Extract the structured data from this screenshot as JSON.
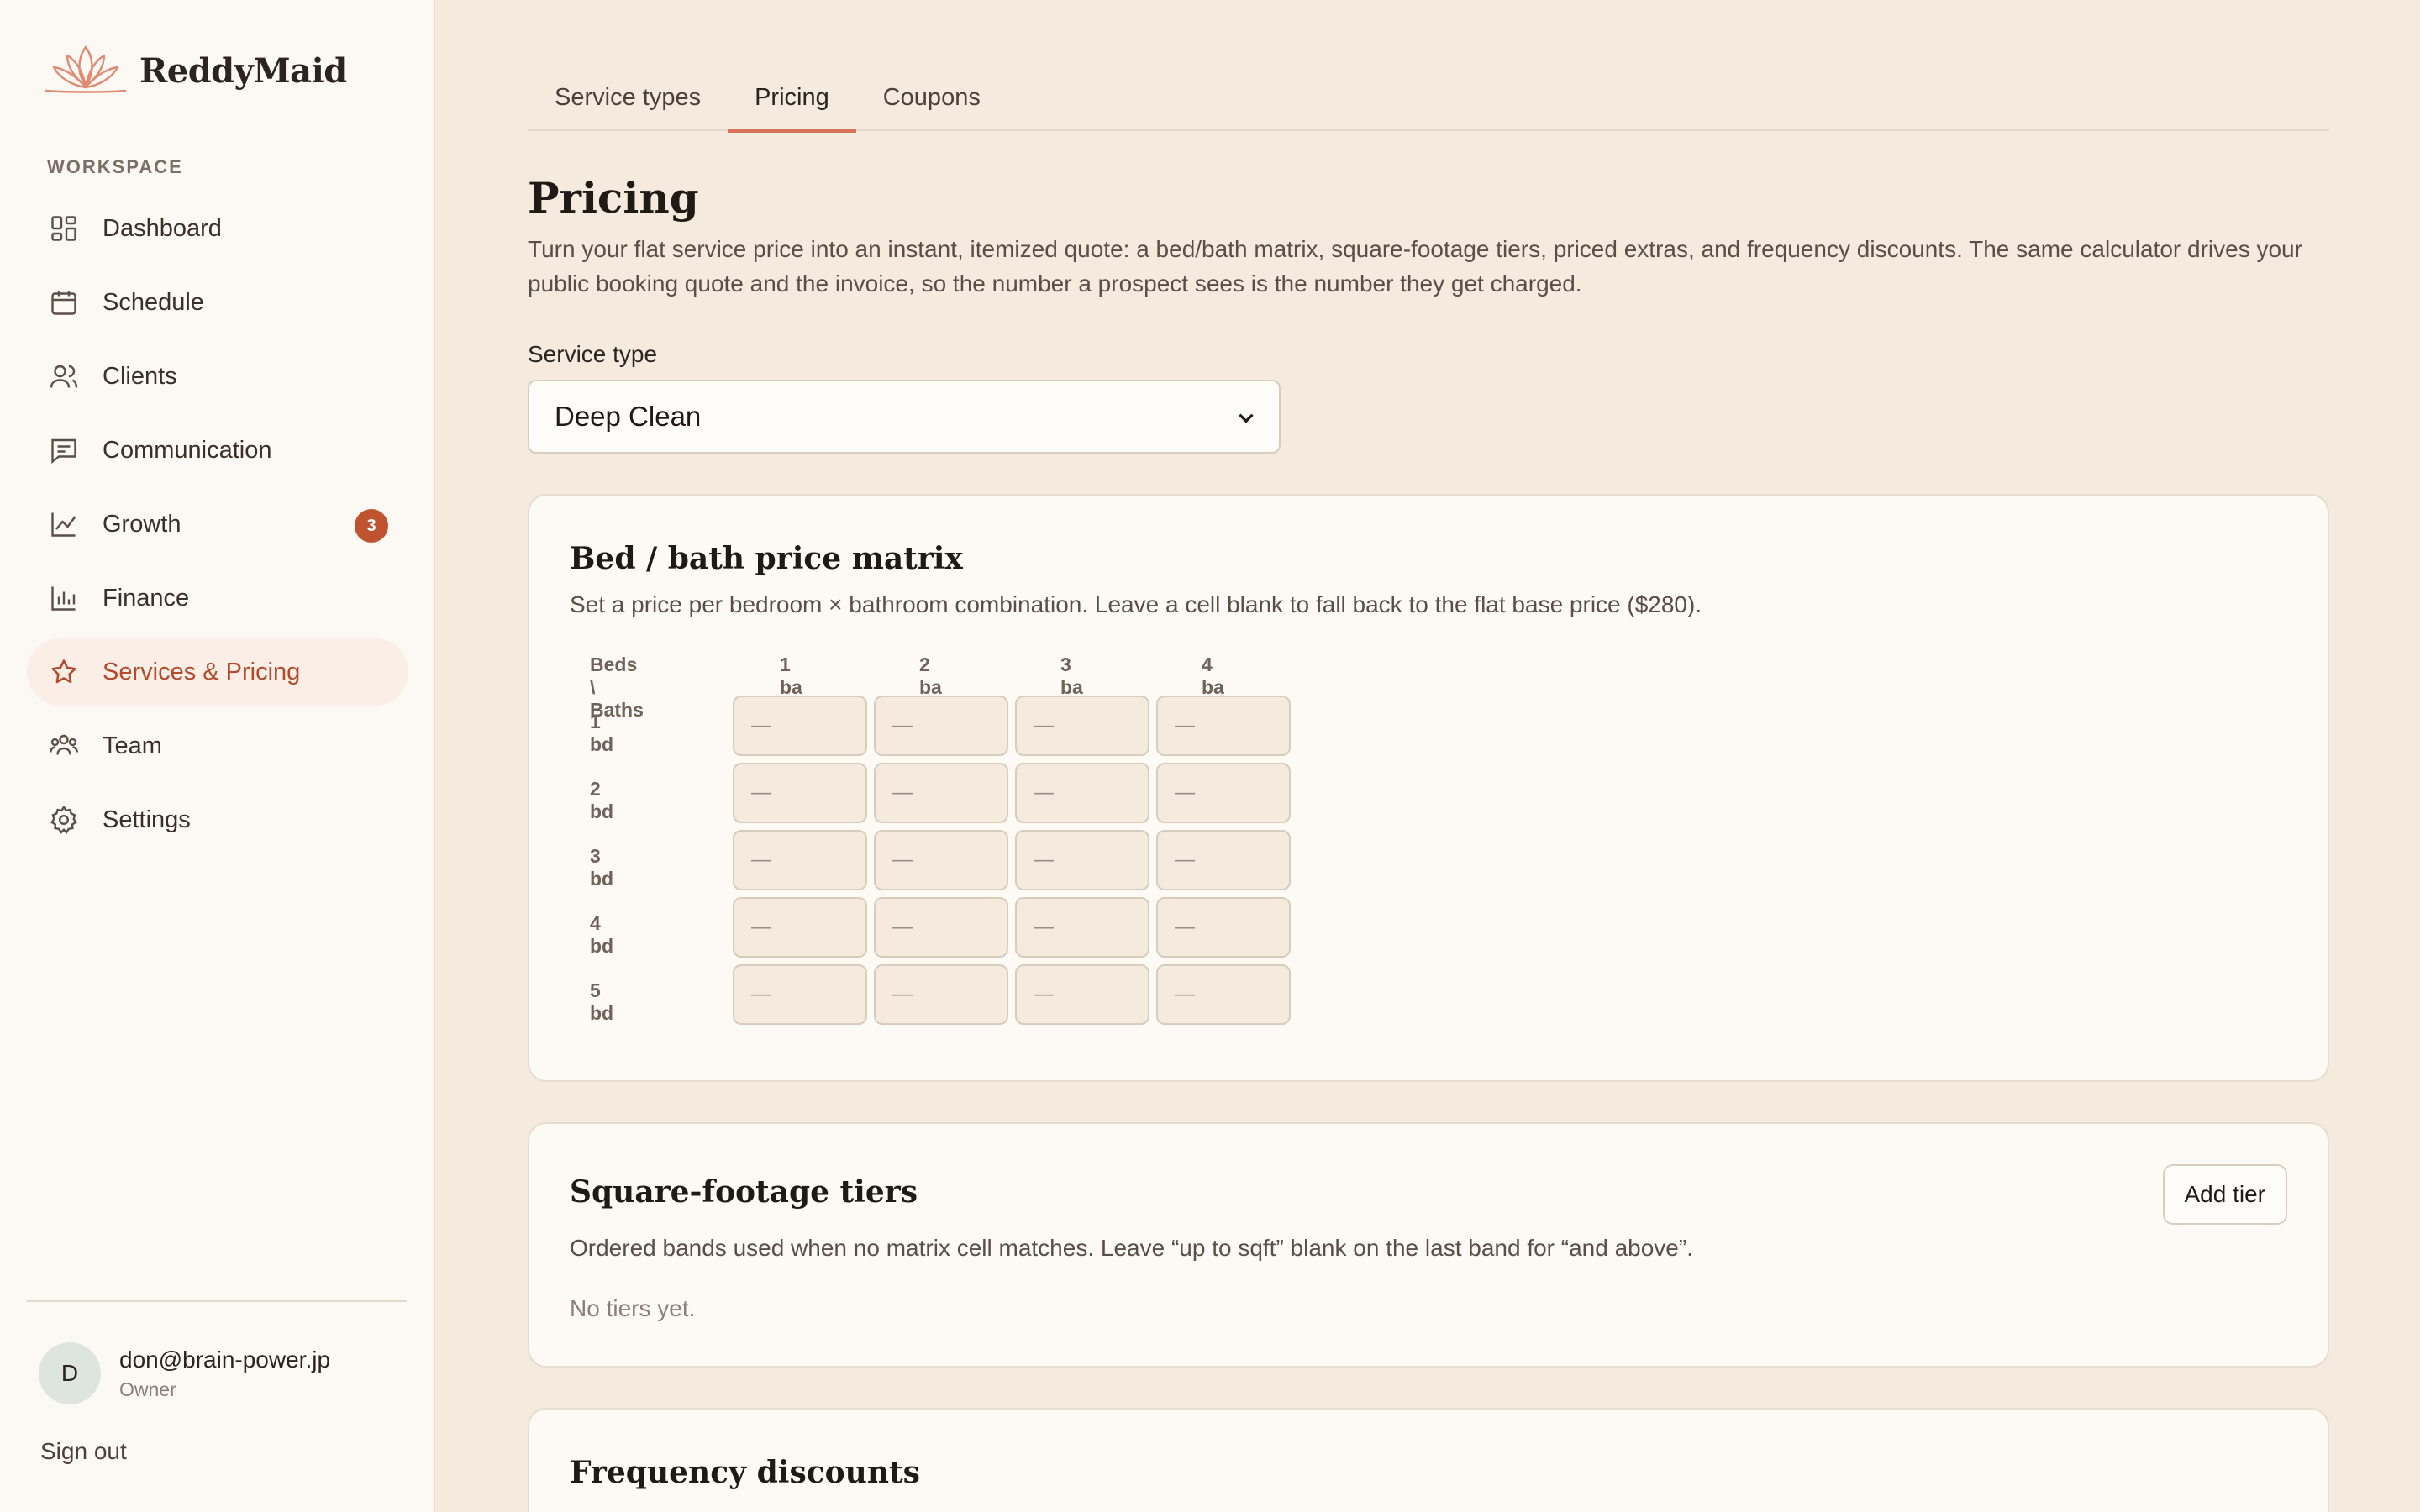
{
  "brand": {
    "name": "ReddyMaid",
    "accent": "#c0532f"
  },
  "sidebar": {
    "section_label": "WORKSPACE",
    "items": [
      {
        "label": "Dashboard",
        "icon": "dashboard-icon"
      },
      {
        "label": "Schedule",
        "icon": "calendar-icon"
      },
      {
        "label": "Clients",
        "icon": "users-icon"
      },
      {
        "label": "Communication",
        "icon": "message-icon"
      },
      {
        "label": "Growth",
        "icon": "chart-line-icon",
        "badge": "3"
      },
      {
        "label": "Finance",
        "icon": "bar-chart-icon"
      },
      {
        "label": "Services & Pricing",
        "icon": "star-icon",
        "active": true
      },
      {
        "label": "Team",
        "icon": "team-icon"
      },
      {
        "label": "Settings",
        "icon": "gear-icon"
      }
    ],
    "user": {
      "initial": "D",
      "email": "don@brain-power.jp",
      "role": "Owner"
    },
    "signout": "Sign out"
  },
  "tabs": [
    {
      "label": "Service types"
    },
    {
      "label": "Pricing",
      "active": true
    },
    {
      "label": "Coupons"
    }
  ],
  "page": {
    "title": "Pricing",
    "description": "Turn your flat service price into an instant, itemized quote: a bed/bath matrix, square-footage tiers, priced extras, and frequency discounts. The same calculator drives your public booking quote and the invoice, so the number a prospect sees is the number they get charged."
  },
  "service_type": {
    "label": "Service type",
    "value": "Deep Clean"
  },
  "matrix": {
    "title": "Bed / bath price matrix",
    "description": "Set a price per bedroom × bathroom combination. Leave a cell blank to fall back to the flat base price ($280).",
    "corner_label": "Beds \\ Baths",
    "columns": [
      "1 ba",
      "2 ba",
      "3 ba",
      "4 ba"
    ],
    "rows": [
      "1 bd",
      "2 bd",
      "3 bd",
      "4 bd",
      "5 bd"
    ],
    "cell_placeholder": "—"
  },
  "sqft": {
    "title": "Square-footage tiers",
    "description": "Ordered bands used when no matrix cell matches. Leave “up to sqft” blank on the last band for “and above”.",
    "add_button": "Add tier",
    "empty": "No tiers yet."
  },
  "frequency": {
    "title": "Frequency discounts"
  }
}
